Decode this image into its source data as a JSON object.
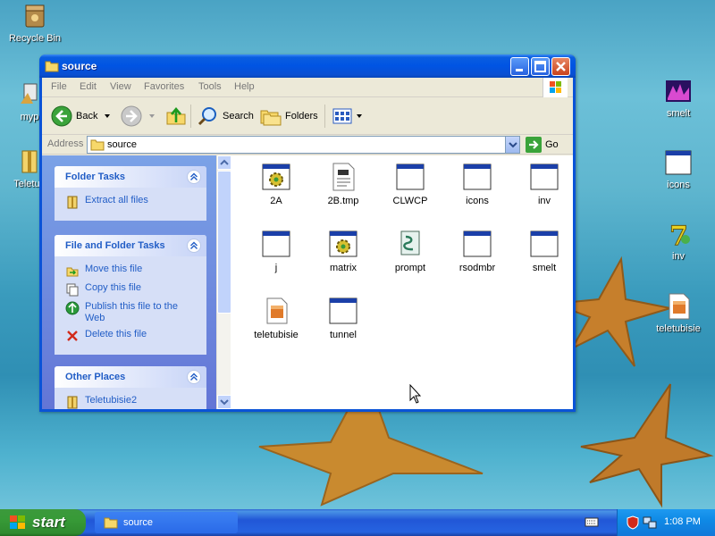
{
  "desktop": {
    "icons": [
      {
        "label": "Recycle Bin",
        "icon": "recycle-bin-icon"
      },
      {
        "label": "myp",
        "icon": "program-icon"
      },
      {
        "label": "Teletub",
        "icon": "zip-icon"
      },
      {
        "label": "smelt",
        "icon": "image-icon"
      },
      {
        "label": "icons",
        "icon": "window-icon"
      },
      {
        "label": "inv",
        "icon": "seven-icon"
      },
      {
        "label": "teletubisie",
        "icon": "package-icon"
      }
    ]
  },
  "window": {
    "title": "source",
    "menu": [
      "File",
      "Edit",
      "View",
      "Favorites",
      "Tools",
      "Help"
    ],
    "toolbar": {
      "back": "Back",
      "search": "Search",
      "folders": "Folders"
    },
    "address": {
      "label": "Address",
      "value": "source",
      "go": "Go"
    },
    "folder_tasks": {
      "title": "Folder Tasks",
      "items": [
        {
          "label": "Extract all files",
          "icon": "extract-icon"
        }
      ]
    },
    "file_tasks": {
      "title": "File and Folder Tasks",
      "items": [
        {
          "label": "Move this file",
          "icon": "move-icon"
        },
        {
          "label": "Copy this file",
          "icon": "copy-icon"
        },
        {
          "label": "Publish this file to the Web",
          "icon": "publish-icon"
        },
        {
          "label": "Delete this file",
          "icon": "delete-icon"
        }
      ]
    },
    "other_places": {
      "title": "Other Places",
      "items": [
        {
          "label": "Teletubisie2",
          "icon": "zip-icon"
        }
      ]
    },
    "files": [
      {
        "name": "2A",
        "icon": "gear-app-icon"
      },
      {
        "name": "2B.tmp",
        "icon": "text-file-icon"
      },
      {
        "name": "CLWCP",
        "icon": "window-icon"
      },
      {
        "name": "icons",
        "icon": "window-icon"
      },
      {
        "name": "inv",
        "icon": "window-icon"
      },
      {
        "name": "j",
        "icon": "window-icon"
      },
      {
        "name": "matrix",
        "icon": "gear-app-icon"
      },
      {
        "name": "prompt",
        "icon": "script-icon"
      },
      {
        "name": "rsodmbr",
        "icon": "window-icon"
      },
      {
        "name": "smelt",
        "icon": "window-icon"
      },
      {
        "name": "teletubisie",
        "icon": "package-icon"
      },
      {
        "name": "tunnel",
        "icon": "window-icon"
      }
    ]
  },
  "taskbar": {
    "start": "start",
    "task_button": "source",
    "clock": "1:08 PM"
  },
  "colors": {
    "title_blue": "#0054e3",
    "task_link": "#215dc6",
    "start_green": "#379a37"
  }
}
